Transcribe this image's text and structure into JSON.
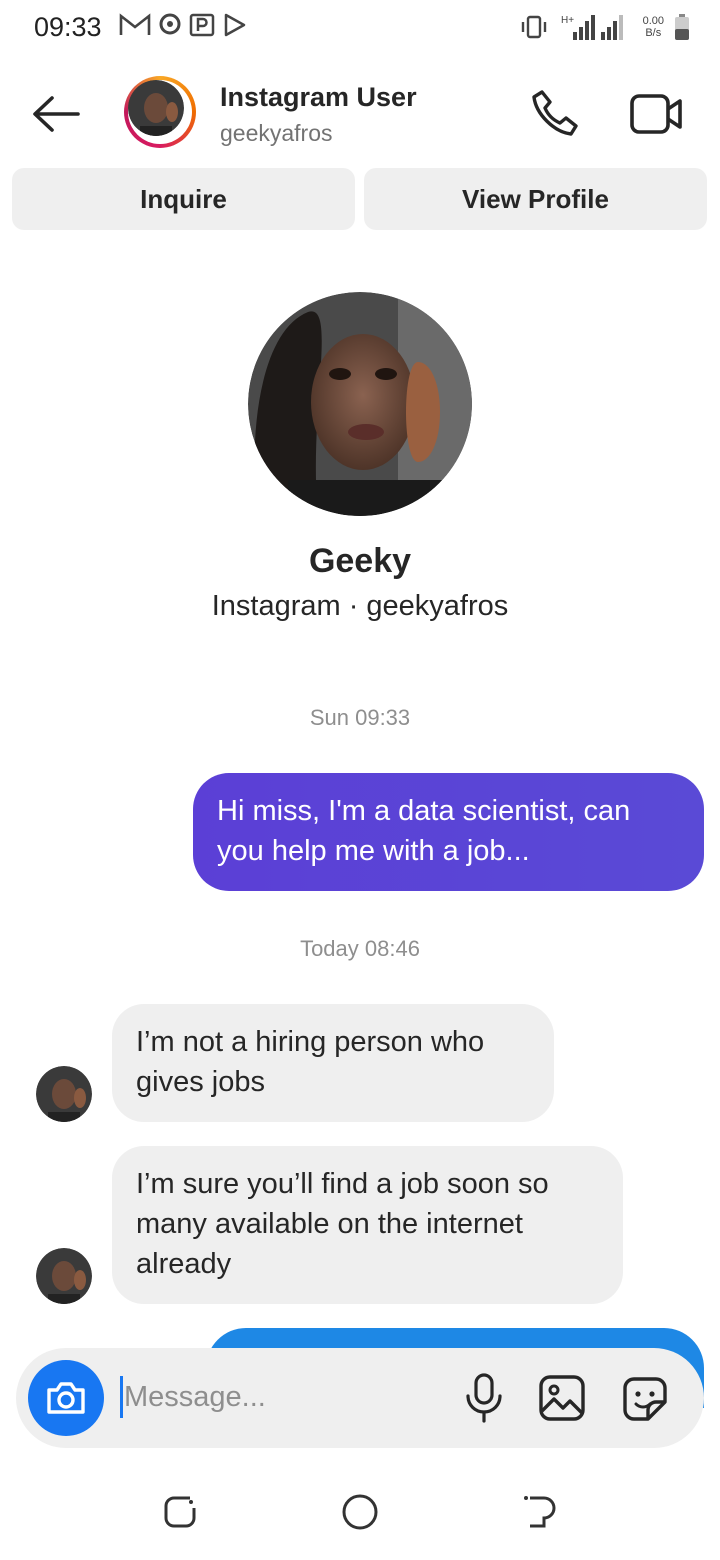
{
  "status_bar": {
    "time": "09:33",
    "net_speed_value": "0.00",
    "net_speed_unit": "B/s",
    "network_type": "H+"
  },
  "header": {
    "name": "Instagram User",
    "handle": "geekyafros"
  },
  "actions": {
    "inquire_label": "Inquire",
    "view_profile_label": "View Profile"
  },
  "profile": {
    "display_name": "Geeky",
    "subtitle": "Instagram · geekyafros"
  },
  "messages": [
    {
      "timestamp": "Sun 09:33"
    },
    {
      "sender": "me",
      "text": "Hi miss, I'm a data scientist, can you help me with a job..."
    },
    {
      "timestamp": "Today 08:46"
    },
    {
      "sender": "them",
      "text": "I’m not a hiring person who gives jobs"
    },
    {
      "sender": "them",
      "text": "I’m sure you’ll find a job soon so many available on the internet already"
    }
  ],
  "composer": {
    "placeholder": "Message..."
  },
  "colors": {
    "accent": "#1877f2",
    "outgoing_bubble": "#5a45d6",
    "incoming_bubble": "#efefef",
    "secondary_text": "#8e8e8e"
  }
}
